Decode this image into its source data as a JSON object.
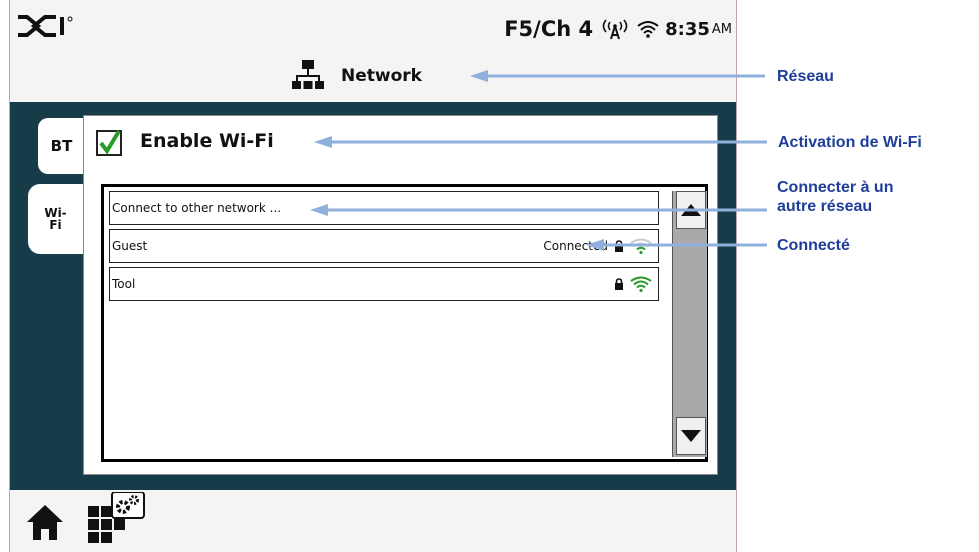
{
  "status_bar": {
    "logo_icon": "dci-logo",
    "channel": "F5/Ch 4",
    "antenna_icon": "telemetry-antenna-icon",
    "wifi_icon": "wifi-icon",
    "time": "8:35",
    "ampm": "AM"
  },
  "header": {
    "icon": "network-icon",
    "title": "Network"
  },
  "tabs": [
    {
      "label": "BT",
      "active": false
    },
    {
      "label": "Wi-\nFi",
      "active": true
    }
  ],
  "enable_wifi": {
    "label": "Enable Wi-Fi",
    "checked": true
  },
  "networks": [
    {
      "name": "Connect to other network ...",
      "status": "",
      "locked": false,
      "signal": false
    },
    {
      "name": "Guest",
      "status": "Connected",
      "locked": true,
      "signal": true
    },
    {
      "name": "Tool",
      "status": "",
      "locked": true,
      "signal": true
    }
  ],
  "bottom_bar": {
    "home_icon": "home-icon",
    "settings_icon": "settings-menu-icon"
  },
  "annotations": {
    "reseau": "Réseau",
    "activation": "Activation de Wi-Fi",
    "connecter": "Connecter à un\nautre réseau",
    "connecte": "Connecté"
  },
  "colors": {
    "annotation_text": "#1f3d99",
    "arrow": "#8fb0dd",
    "background_dark": "#163c4a",
    "tab_accent": "#2a8a2a",
    "check": "#2a9a2a"
  }
}
